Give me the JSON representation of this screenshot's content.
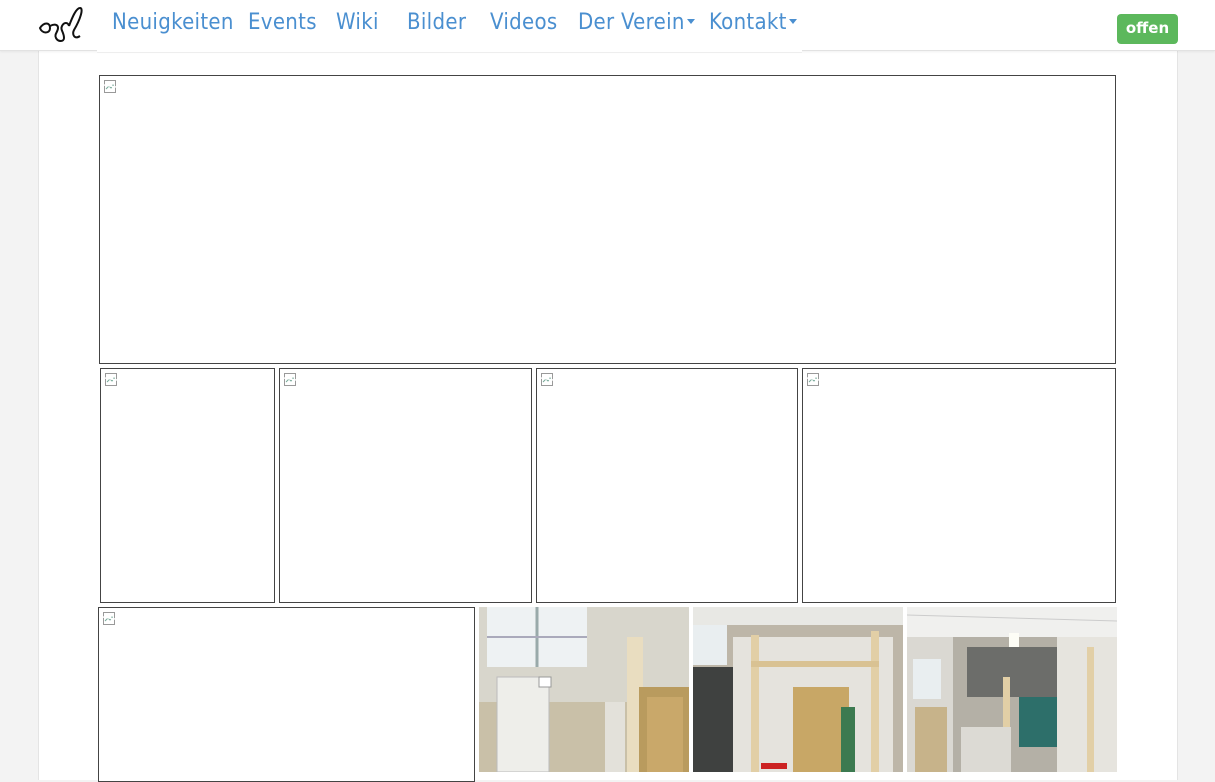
{
  "brand": {
    "logo_text": "ozl"
  },
  "nav": {
    "items": [
      {
        "label": "Neuigkeiten",
        "dropdown": false
      },
      {
        "label": "Events",
        "dropdown": false
      },
      {
        "label": "Wiki",
        "dropdown": false
      },
      {
        "label": "Bilder",
        "dropdown": false
      },
      {
        "label": "Videos",
        "dropdown": false
      },
      {
        "label": "Der Verein",
        "dropdown": true
      },
      {
        "label": "Kontakt",
        "dropdown": true
      }
    ]
  },
  "status": {
    "label": "offen",
    "color": "#5cb85c"
  },
  "colors": {
    "link": "#4a8fd0",
    "background": "#f3f3f3"
  },
  "gallery": {
    "broken_icon": "broken-image-icon",
    "images": [
      {
        "state": "broken"
      },
      {
        "state": "broken"
      },
      {
        "state": "broken"
      },
      {
        "state": "broken"
      },
      {
        "state": "broken"
      },
      {
        "state": "broken"
      },
      {
        "state": "photo",
        "subject": "workshop-wall-window"
      },
      {
        "state": "photo",
        "subject": "workshop-frame-construction"
      },
      {
        "state": "photo",
        "subject": "workshop-hall-frames"
      }
    ]
  }
}
